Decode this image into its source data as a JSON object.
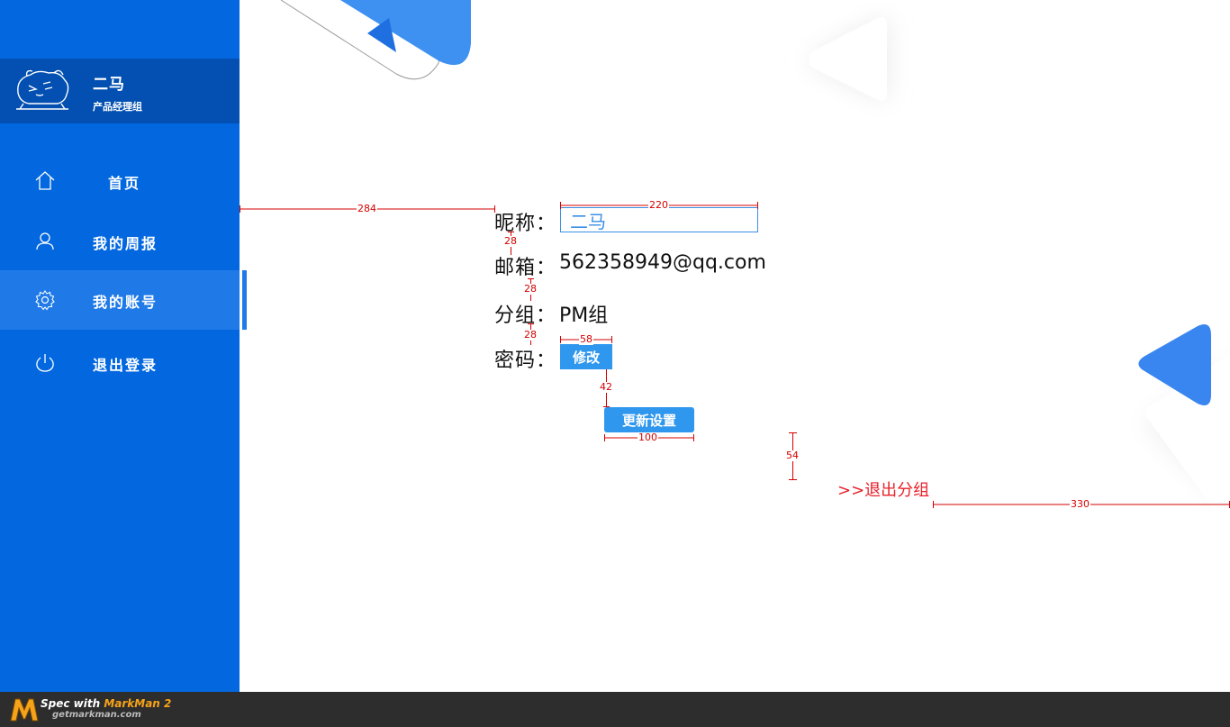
{
  "sidebar": {
    "profile": {
      "name": "二马",
      "group": "产品经理组",
      "avatar_icon": "cartoon-avatar-icon"
    },
    "items": [
      {
        "label": "首页",
        "icon": "home-icon",
        "active": false
      },
      {
        "label": "我的周报",
        "icon": "user-icon",
        "active": false
      },
      {
        "label": "我的账号",
        "icon": "gear-icon",
        "active": true
      },
      {
        "label": "退出登录",
        "icon": "power-icon",
        "active": false
      }
    ]
  },
  "account": {
    "nickname_label": "昵称：",
    "nickname_value": "二马",
    "email_label": "邮箱：",
    "email_value": "562358949@qq.com",
    "group_label": "分组：",
    "group_value": "PM组",
    "password_label": "密码：",
    "modify_button": "修改",
    "update_button": "更新设置",
    "quit_group_link": ">>退出分组"
  },
  "spec": {
    "left_offset": "284",
    "input_width": "220",
    "row_gap_1": "28",
    "row_gap_2": "28",
    "row_gap_3": "28",
    "modify_width": "58",
    "button_gap": "42",
    "update_width": "100",
    "link_gap": "54",
    "right_offset": "330"
  },
  "footer": {
    "spec_prefix": "Spec with ",
    "brand": "MarkMan 2",
    "url": "getmarkman.com"
  },
  "colors": {
    "sidebar": "#0368e0",
    "profile": "#0350b2",
    "active": "#1f7ae8",
    "button": "#2f97ee",
    "link": "#e8202a",
    "spec": "#d40000"
  }
}
